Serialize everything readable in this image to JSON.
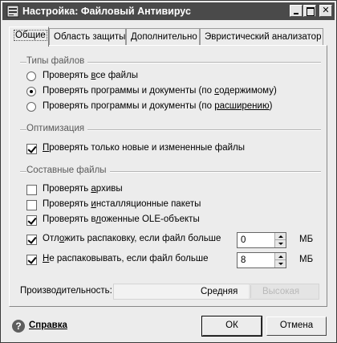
{
  "window": {
    "title": "Настройка: Файловый Антивирус"
  },
  "tabs": [
    {
      "label": "Общие",
      "active": true
    },
    {
      "label": "Область защиты",
      "active": false
    },
    {
      "label": "Дополнительно",
      "active": false
    },
    {
      "label": "Эвристический анализатор",
      "active": false
    }
  ],
  "file_types": {
    "title": "Типы файлов",
    "options": [
      {
        "label": "Проверять все файлы",
        "selected": false
      },
      {
        "label": "Проверять программы и документы (по содержимому)",
        "selected": true
      },
      {
        "label": "Проверять программы и документы (по расширению)",
        "selected": false
      }
    ]
  },
  "optimization": {
    "title": "Оптимизация",
    "options": [
      {
        "label": "Проверять только новые и измененные файлы",
        "checked": true
      }
    ]
  },
  "compound": {
    "title": "Составные файлы",
    "options": [
      {
        "label": "Проверять архивы",
        "checked": false
      },
      {
        "label": "Проверять инсталляционные пакеты",
        "checked": false
      },
      {
        "label": "Проверять вложенные OLE-объекты",
        "checked": true
      },
      {
        "label": "Отложить распаковку, если файл больше",
        "checked": true,
        "value": "0",
        "unit": "МБ"
      },
      {
        "label": "Не распаковывать, если файл больше",
        "checked": true,
        "value": "8",
        "unit": "МБ"
      }
    ]
  },
  "performance": {
    "label": "Производительность:",
    "current": "Средняя",
    "next": "Высокая",
    "level_fraction": 0.66
  },
  "footer": {
    "help_label": "Справка",
    "ok_label": "ОК",
    "cancel_label": "Отмена"
  }
}
